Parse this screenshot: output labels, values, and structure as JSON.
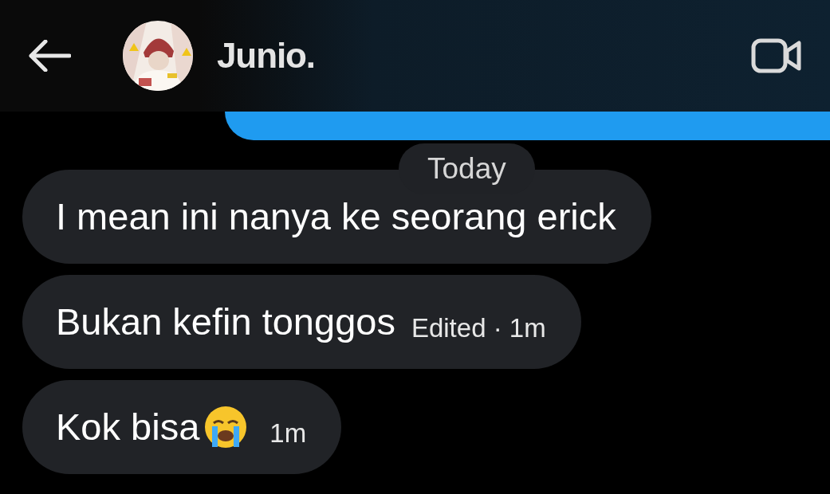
{
  "header": {
    "contact_name": "Junio."
  },
  "date_divider": "Today",
  "messages": [
    {
      "text": "I mean ini nanya ke seorang erick",
      "emoji": false
    },
    {
      "text": "Bukan kefin tonggos",
      "meta": "Edited · 1m",
      "emoji": false
    },
    {
      "text": "Kok bisa",
      "meta": "1m",
      "emoji": true
    }
  ]
}
